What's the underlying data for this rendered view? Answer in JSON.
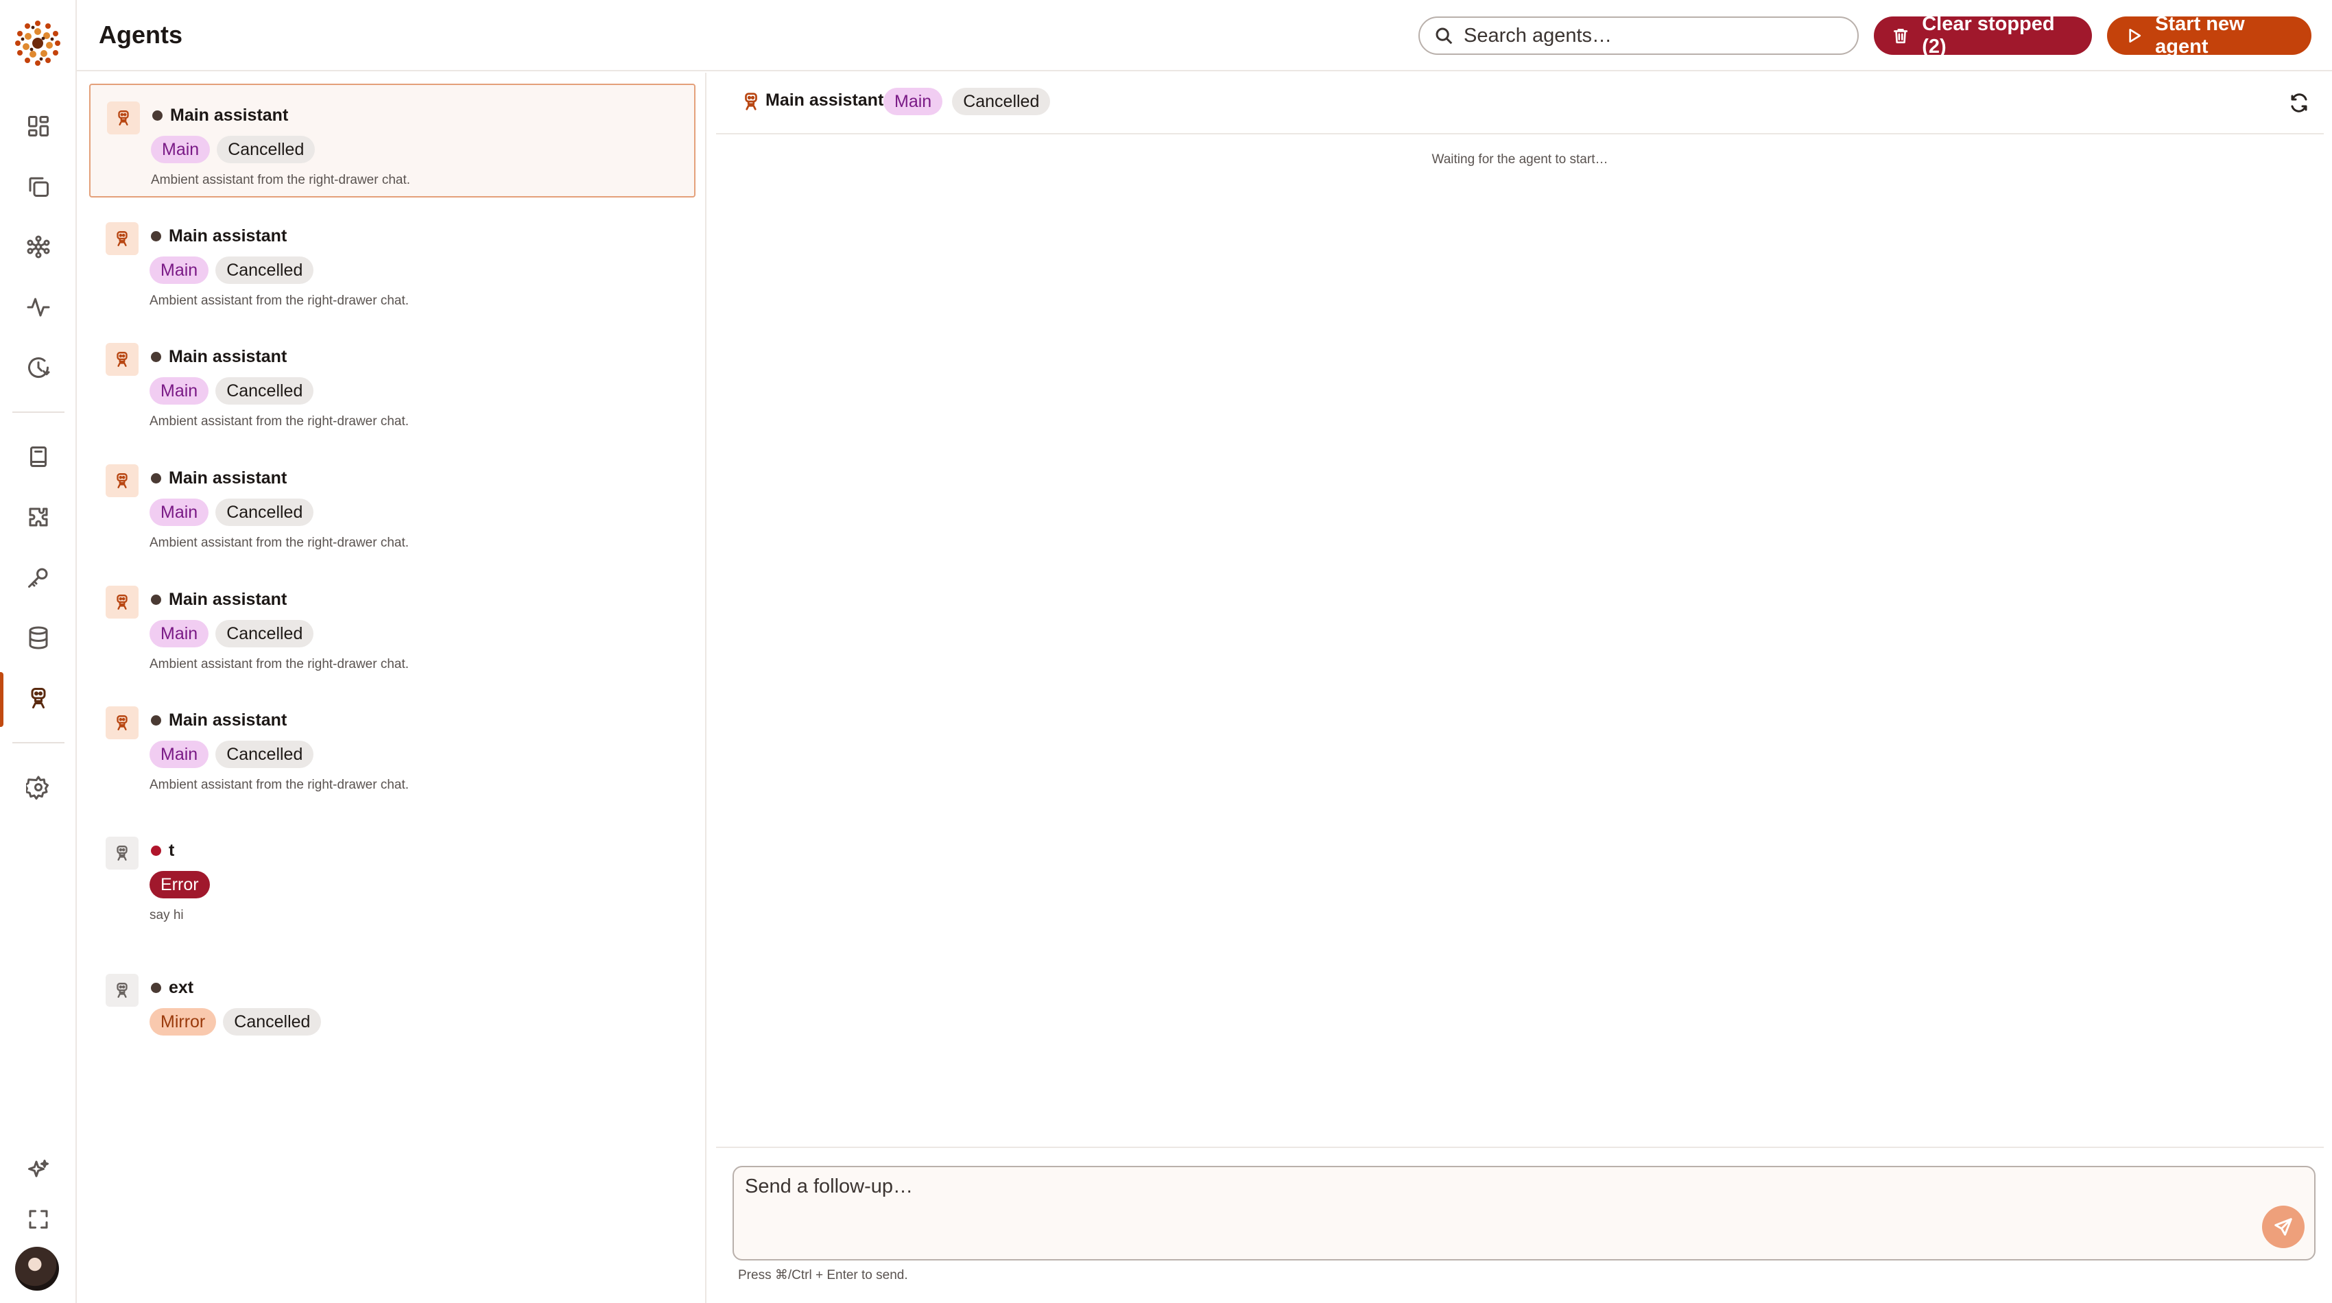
{
  "header": {
    "title": "Agents",
    "search_placeholder": "Search agents…",
    "clear_label": "Clear stopped (2)",
    "start_label": "Start new agent"
  },
  "colors": {
    "accent": "#c4420b",
    "danger": "#a0182c",
    "main_tag_bg": "#f1cdf2",
    "mirror_tag_bg": "#f9c9ae"
  },
  "rail": {
    "items": [
      {
        "icon": "dashboard-icon"
      },
      {
        "icon": "copy-icon"
      },
      {
        "icon": "workflow-icon"
      },
      {
        "icon": "activity-icon"
      },
      {
        "icon": "history-icon"
      },
      {
        "icon": "book-icon"
      },
      {
        "icon": "puzzle-icon"
      },
      {
        "icon": "key-icon"
      },
      {
        "icon": "database-icon"
      },
      {
        "icon": "agent-icon",
        "active": true
      },
      {
        "icon": "settings-icon"
      },
      {
        "icon": "sparkles-icon"
      },
      {
        "icon": "fullscreen-icon"
      }
    ]
  },
  "agents": [
    {
      "name": "Main assistant",
      "tags": [
        "Main",
        "Cancelled"
      ],
      "desc": "Ambient assistant from the right-drawer chat.",
      "selected": true
    },
    {
      "name": "Main assistant",
      "tags": [
        "Main",
        "Cancelled"
      ],
      "desc": "Ambient assistant from the right-drawer chat."
    },
    {
      "name": "Main assistant",
      "tags": [
        "Main",
        "Cancelled"
      ],
      "desc": "Ambient assistant from the right-drawer chat."
    },
    {
      "name": "Main assistant",
      "tags": [
        "Main",
        "Cancelled"
      ],
      "desc": "Ambient assistant from the right-drawer chat."
    },
    {
      "name": "Main assistant",
      "tags": [
        "Main",
        "Cancelled"
      ],
      "desc": "Ambient assistant from the right-drawer chat."
    },
    {
      "name": "Main assistant",
      "tags": [
        "Main",
        "Cancelled"
      ],
      "desc": "Ambient assistant from the right-drawer chat."
    },
    {
      "name": "t",
      "tags": [
        "Error"
      ],
      "desc": "say hi"
    },
    {
      "name": "ext",
      "tags": [
        "Mirror",
        "Cancelled"
      ],
      "desc": ""
    }
  ],
  "detail": {
    "name": "Main assistant",
    "tags": [
      "Main",
      "Cancelled"
    ],
    "waiting": "Waiting for the agent to start…",
    "composer_placeholder": "Send a follow-up…",
    "hint": "Press ⌘/Ctrl + Enter to send."
  }
}
